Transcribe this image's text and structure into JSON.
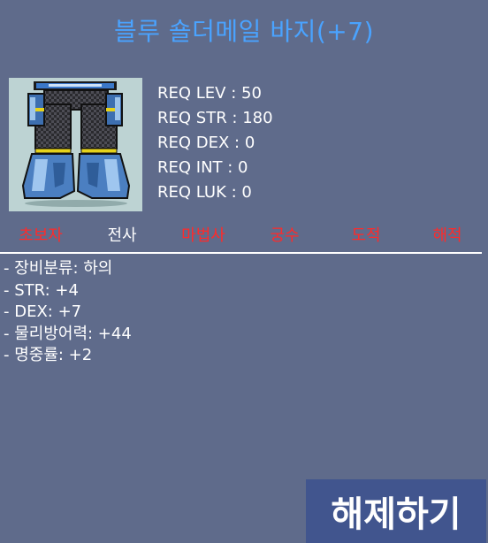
{
  "item": {
    "name": "블루 숄더메일 바지(+7)"
  },
  "requirements": [
    "REQ LEV : 50",
    "REQ STR : 180",
    "REQ DEX : 0",
    "REQ INT : 0",
    "REQ LUK : 0"
  ],
  "jobs": [
    {
      "label": "초보자",
      "color": "#ff2a2a"
    },
    {
      "label": "전사",
      "color": "#ffffff"
    },
    {
      "label": "마법사",
      "color": "#ff2a2a"
    },
    {
      "label": "궁수",
      "color": "#ff2a2a"
    },
    {
      "label": "도적",
      "color": "#ff2a2a"
    },
    {
      "label": "해적",
      "color": "#ff2a2a"
    }
  ],
  "stats": [
    "- 장비분류: 하의",
    "- STR: +4",
    "- DEX: +7",
    "- 물리방어력: +44",
    "- 명중률: +2"
  ],
  "actions": {
    "unequip_label": "해제하기"
  },
  "icon": {
    "name": "blue-shouldermail-pants-icon"
  },
  "colors": {
    "background": "#5f6b8b",
    "title": "#4aa3ff",
    "ineligible_job": "#ff2a2a",
    "eligible_job": "#ffffff",
    "button": "#41558e"
  }
}
